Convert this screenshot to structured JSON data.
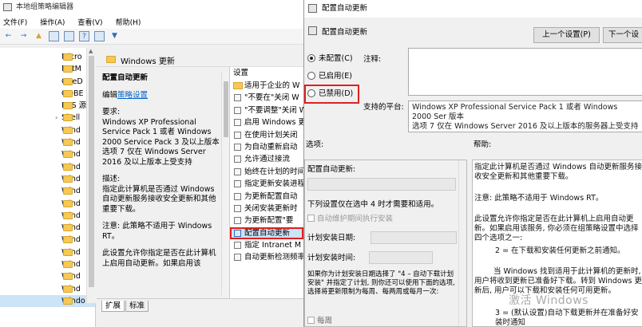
{
  "gpe": {
    "title": "本地组策略编辑器",
    "menu": [
      "文件(F)",
      "操作(A)",
      "查看(V)",
      "帮助(H)"
    ],
    "tree": [
      "Micro",
      "NetM",
      "OneD",
      "OOBE",
      "RSS 源",
      "Shell",
      "Wind",
      "Wind",
      "Wind",
      "Wind",
      "Wind",
      "Wind",
      "Wind",
      "Wind",
      "Wind",
      "Wind",
      "Wind",
      "Wind",
      "Wind",
      "Wind",
      "Windo"
    ],
    "content_header": "Windows 更新",
    "desc": {
      "title": "配置自动更新",
      "edit_prefix": "编辑",
      "edit_link": "策略设置",
      "req_label": "要求:",
      "req_text": "Windows XP Professional Service Pack 1 或者 Windows 2000 Service Pack 3 及以上版本 选项 7 仅在 Windows Server 2016 及以上版本上受支持",
      "desc_label": "描述:",
      "desc_text": "指定此计算机是否通过 Windows 自动更新服务接收安全更新和其他重要下载。",
      "note": "注意: 此策略不适用于 Windows RT。",
      "more": "此设置允许你指定是否在此计算机上启用自动更新。如果启用该"
    },
    "settings_header": "设置",
    "settings": [
      "适用于企业的 W",
      "\"不要在\"关闭 W",
      "\"不要调整\"关闭 W",
      "启用 Windows 更",
      "在使用计划关闭",
      "为自动重新启动",
      "允许通过接流",
      "始终在计划的时间",
      "指定更新安装进程",
      "为更新配置自动",
      "关闭安装更新时",
      "为更新配置\"要",
      "配置自动更新",
      "指定 Intranet M",
      "自动更新检测频率"
    ],
    "tabs": [
      "扩展",
      "标准"
    ]
  },
  "dialog": {
    "title": "配置自动更新",
    "subtitle": "配置自动更新",
    "prev_btn": "上一个设置(P)",
    "next_btn": "下一个设",
    "radios": [
      {
        "label": "未配置(C)",
        "checked": true
      },
      {
        "label": "已启用(E)",
        "checked": false
      },
      {
        "label": "已禁用(D)",
        "checked": false
      }
    ],
    "comment_label": "注释:",
    "platform_label": "支持的平台:",
    "platform_text": "Windows XP Professional Service Pack 1 或者 Windows 2000 Ser 版本",
    "platform_text2": "选项 7 仅在 Windows Server 2016 及以上版本的服务器上受支持",
    "options_label": "选项:",
    "help_label": "帮助:",
    "options": {
      "title": "配置自动更新:",
      "line1": "下列设置仅在选中 4 时才需要和适用。",
      "chk1": "自动维护期间执行安装",
      "sched_day": "计划安装日期:",
      "sched_time": "计划安装时间:",
      "para": "如果你为计划安装日期选择了 \"4 – 自动下载计划安装\" 并指定了计划, 则你还可以使用下面的选项, 选择将更新限制为每周、每两周或每月一次:",
      "weekly": "每周"
    },
    "help": {
      "p1": "指定此计算机是否通过 Windows 自动更新服务接收安全更新和其他重要下载。",
      "p2": "注意: 此策略不适用于 Windows RT。",
      "p3": "此设置允许你指定是否在此计算机上启用自动更新。如果启用该服务, 你必须在组策略设置中选择四个选项之一:",
      "p4": "2 = 在下载和安装任何更新之前通知。",
      "p5": "当 Windows 找到适用于此计算机的更新时, 用户将收到更新已准备好下载。转到 Windows 更新后, 用户可以下载和安装任何可用更新。",
      "p6": "3 = (默认设置)自动下载更新并在准备好安装时通知"
    },
    "watermark": "激活 Windows"
  },
  "colors": {
    "highlight": "#e02020",
    "selection": "#cce4f7",
    "folder": "#f5c952"
  }
}
